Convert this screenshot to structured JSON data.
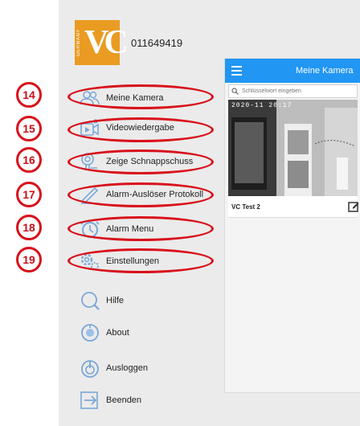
{
  "header": {
    "logo_text": "VC",
    "logo_subtext": "GERMANY",
    "user_id": "011649419"
  },
  "menu": {
    "items": [
      {
        "id": "meine-kamera",
        "label": "Meine Kamera",
        "icon": "users-icon",
        "number": "14"
      },
      {
        "id": "videowiedergabe",
        "label": "Videowiedergabe",
        "icon": "video-playback-icon",
        "number": "15"
      },
      {
        "id": "zeige-schnappschuss",
        "label": "Zeige Schnappschuss",
        "icon": "snapshot-icon",
        "number": "16"
      },
      {
        "id": "alarm-ausloeser-protokoll",
        "label": "Alarm-Auslöser Protokoll",
        "icon": "pen-log-icon",
        "number": "17"
      },
      {
        "id": "alarm-menu",
        "label": "Alarm Menu",
        "icon": "alarm-clock-icon",
        "number": "18"
      },
      {
        "id": "einstellungen",
        "label": "Einstellungen",
        "icon": "gears-icon",
        "number": "19"
      },
      {
        "id": "hilfe",
        "label": "Hilfe",
        "icon": "help-icon"
      },
      {
        "id": "about",
        "label": "About",
        "icon": "about-icon"
      },
      {
        "id": "ausloggen",
        "label": "Ausloggen",
        "icon": "power-icon"
      },
      {
        "id": "beenden",
        "label": "Beenden",
        "icon": "exit-icon"
      }
    ]
  },
  "app": {
    "title": "Meine Kamera",
    "search_placeholder": "Schlüsselwort eingeben",
    "camera": {
      "name": "VC Test 2",
      "timestamp": "2020-11 20:17"
    }
  },
  "colors": {
    "accent": "#2196f3",
    "logo": "#e99b22",
    "annotation": "#d8101a",
    "icon": "#7aa7d8"
  }
}
